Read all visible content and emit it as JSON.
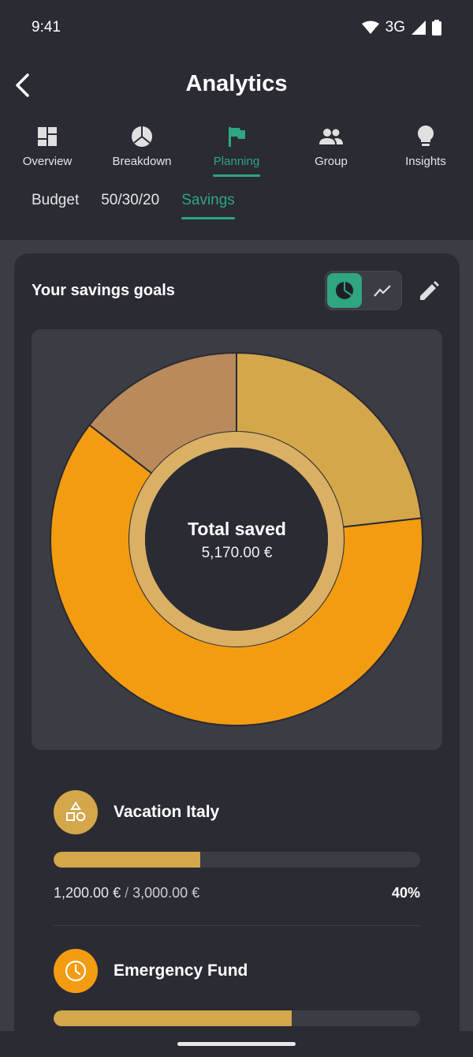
{
  "status_bar": {
    "time": "9:41",
    "network": "3G"
  },
  "header": {
    "title": "Analytics",
    "back_icon": "chevron-left-icon"
  },
  "tabs": [
    {
      "label": "Overview",
      "icon": "dashboard-icon",
      "active": false
    },
    {
      "label": "Breakdown",
      "icon": "pie-icon",
      "active": false
    },
    {
      "label": "Planning",
      "icon": "flag-icon",
      "active": true
    },
    {
      "label": "Group",
      "icon": "group-icon",
      "active": false
    },
    {
      "label": "Insights",
      "icon": "lightbulb-icon",
      "active": false
    }
  ],
  "subtabs": [
    {
      "label": "Budget",
      "active": false
    },
    {
      "label": "50/30/20",
      "active": false
    },
    {
      "label": "Savings",
      "active": true
    }
  ],
  "card": {
    "title": "Your savings goals",
    "toggle": [
      "pie-chart-icon",
      "line-chart-icon"
    ],
    "edit_icon": "pencil-icon"
  },
  "chart_data": {
    "type": "pie",
    "center_label": "Total saved",
    "center_value": "5,170.00 €",
    "slices": [
      {
        "color": "#d3a74a",
        "fraction": 0.232
      },
      {
        "color": "#f39c12",
        "fraction": 0.623
      },
      {
        "color": "#b98a5c",
        "fraction": 0.145
      }
    ]
  },
  "goals": [
    {
      "name": "Vacation Italy",
      "icon": "shapes-icon",
      "color": "#d3a74a",
      "saved": "1,200.00 €",
      "separator": "/",
      "target": "3,000.00 €",
      "percent_label": "40%",
      "progress": 0.4
    },
    {
      "name": "Emergency Fund",
      "icon": "clock-icon",
      "color": "#f39c12",
      "progress": 0.65
    }
  ],
  "colors": {
    "accent": "#2fa580",
    "background": "#2a2b33",
    "surface": "#3b3c44"
  }
}
